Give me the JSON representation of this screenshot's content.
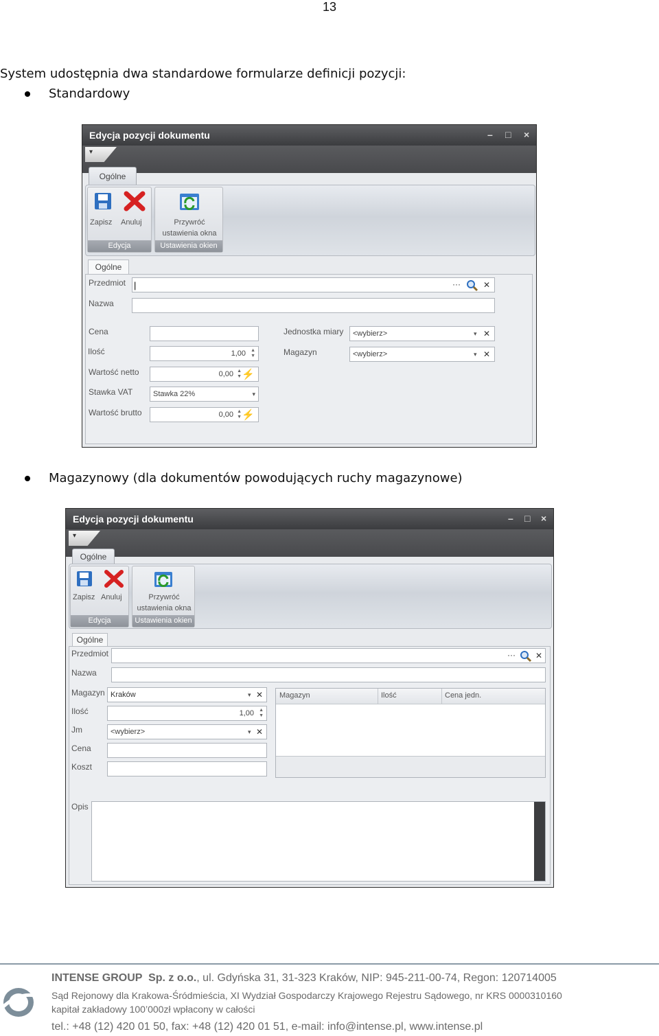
{
  "page_number": "13",
  "intro": "System udostępnia dwa standardowe formularze definicji pozycji:",
  "bullets": [
    "Standardowy",
    "Magazynowy (dla dokumentów powodujących ruchy magazynowe)"
  ],
  "dialog1": {
    "title": "Edycja pozycji dokumentu",
    "window_controls": [
      "–",
      "□",
      "×"
    ],
    "ribbon_tab": "Ogólne",
    "group_edycja": {
      "label": "Edycja",
      "save": "Zapisz",
      "cancel": "Anuluj"
    },
    "group_okna": {
      "label": "Ustawienia okien",
      "restore_line1": "Przywróć",
      "restore_line2": "ustawienia okna"
    },
    "form_tab": "Ogólne",
    "labels": {
      "przedmiot": "Przedmiot",
      "nazwa": "Nazwa",
      "cena": "Cena",
      "ilosc": "Ilość",
      "netto": "Wartość netto",
      "vat": "Stawka VAT",
      "brutto": "Wartość brutto",
      "jm": "Jednostka miary",
      "magazyn": "Magazyn"
    },
    "values": {
      "ilosc": "1,00",
      "netto": "0,00",
      "vat": "Stawka 22%",
      "brutto": "0,00",
      "jm": "<wybierz>",
      "magazyn": "<wybierz>"
    }
  },
  "dialog2": {
    "title": "Edycja pozycji dokumentu",
    "window_controls": [
      "–",
      "□",
      "×"
    ],
    "ribbon_tab": "Ogólne",
    "group_edycja": {
      "label": "Edycja",
      "save": "Zapisz",
      "cancel": "Anuluj"
    },
    "group_okna": {
      "label": "Ustawienia okien",
      "restore_line1": "Przywróć",
      "restore_line2": "ustawienia okna"
    },
    "form_tab": "Ogólne",
    "labels": {
      "przedmiot": "Przedmiot",
      "nazwa": "Nazwa",
      "magazyn": "Magazyn",
      "ilosc": "Ilość",
      "jm": "Jm",
      "cena": "Cena",
      "koszt": "Koszt",
      "opis": "Opis"
    },
    "values": {
      "magazyn": "Kraków",
      "ilosc": "1,00",
      "jm": "<wybierz>"
    },
    "grid_columns": [
      "Magazyn",
      "Ilość",
      "Cena jedn."
    ]
  },
  "footer": {
    "line1_bold": "INTENSE GROUP  Sp. z o.o.",
    "line1_rest": ", ul. Gdyńska 31, 31-323 Kraków, NIP: 945-211-00-74, Regon: 120714005",
    "line2": "Sąd Rejonowy dla Krakowa-Śródmieścia, XI Wydział Gospodarczy Krajowego Rejestru Sądowego, nr KRS 0000310160",
    "line3": "kapitał zakładowy 100’000zł wpłacony w całości",
    "line4": "tel.: +48 (12) 420 01 50, fax: +48 (12) 420 01 51, e-mail: info@intense.pl, www.intense.pl"
  }
}
